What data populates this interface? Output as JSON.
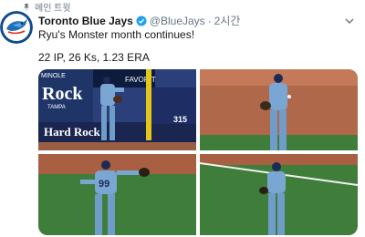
{
  "pinned": {
    "label": "메인 트윗",
    "icon": "pin-icon"
  },
  "account": {
    "name": "Toronto Blue Jays",
    "handle": "@BlueJays",
    "separator": "·",
    "time": "2시간",
    "verified": true,
    "avatar_icon": "blue-jays-logo"
  },
  "tweet": {
    "text": "Ryu's Monster month continues!",
    "stats": "22 IP, 26 Ks, 1.23 ERA"
  },
  "photo1": {
    "sign_top": "MINOLE",
    "sign_main": "Rock",
    "sign_sub": "TAMPA",
    "sign_bottom": "Hard Rock",
    "sign_favorit": "FAVORIT",
    "wall_number": "315"
  },
  "photo3": {
    "jersey_number": "99"
  },
  "colors": {
    "verified": "#1da1f2",
    "muted": "#657786",
    "grass": "#3f7d3a",
    "dirt": "#b0684a",
    "uniform": "#6f9cc9",
    "stadium_blue": "#243a73"
  }
}
